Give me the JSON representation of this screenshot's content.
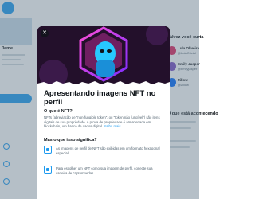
{
  "background": {
    "profile_name": "Jame",
    "right_heading_1": "Talvez você curta",
    "right_heading_2": "O que está acontecendo",
    "suggested_users": [
      {
        "name": "Lula Oliveira",
        "handle": "@LulaOficial"
      },
      {
        "name": "Emily Jasper",
        "handle": "@emilyjasper"
      },
      {
        "name": "Zillow",
        "handle": "@zillow"
      }
    ]
  },
  "modal": {
    "close_icon": "close-icon",
    "title": "Apresentando imagens NFT no perfil",
    "section1_heading": "O que é NFT?",
    "section1_text": "NFTs (abreviação de \"non-fungible token\", ou \"token não fungível\") são itens digitais de sua propriedade. A prova de propriedade é armazenada em blockchain, um banco de dados digital.",
    "section1_link": "Saiba mais",
    "section2_heading": "Mas o que isso significa?",
    "items": [
      {
        "icon": "hexagon-image-icon",
        "text": "As imagens de perfil de NFT são exibidas em um formato hexagonal especial."
      },
      {
        "icon": "wallet-icon",
        "text": "Para escolher um NFT como sua imagem de perfil, conecte sua carteira de criptomoedas."
      }
    ]
  },
  "colors": {
    "accent": "#1d9bf0",
    "hero_bg": "#23102b",
    "text_primary": "#0f1419",
    "text_secondary": "#536471"
  }
}
